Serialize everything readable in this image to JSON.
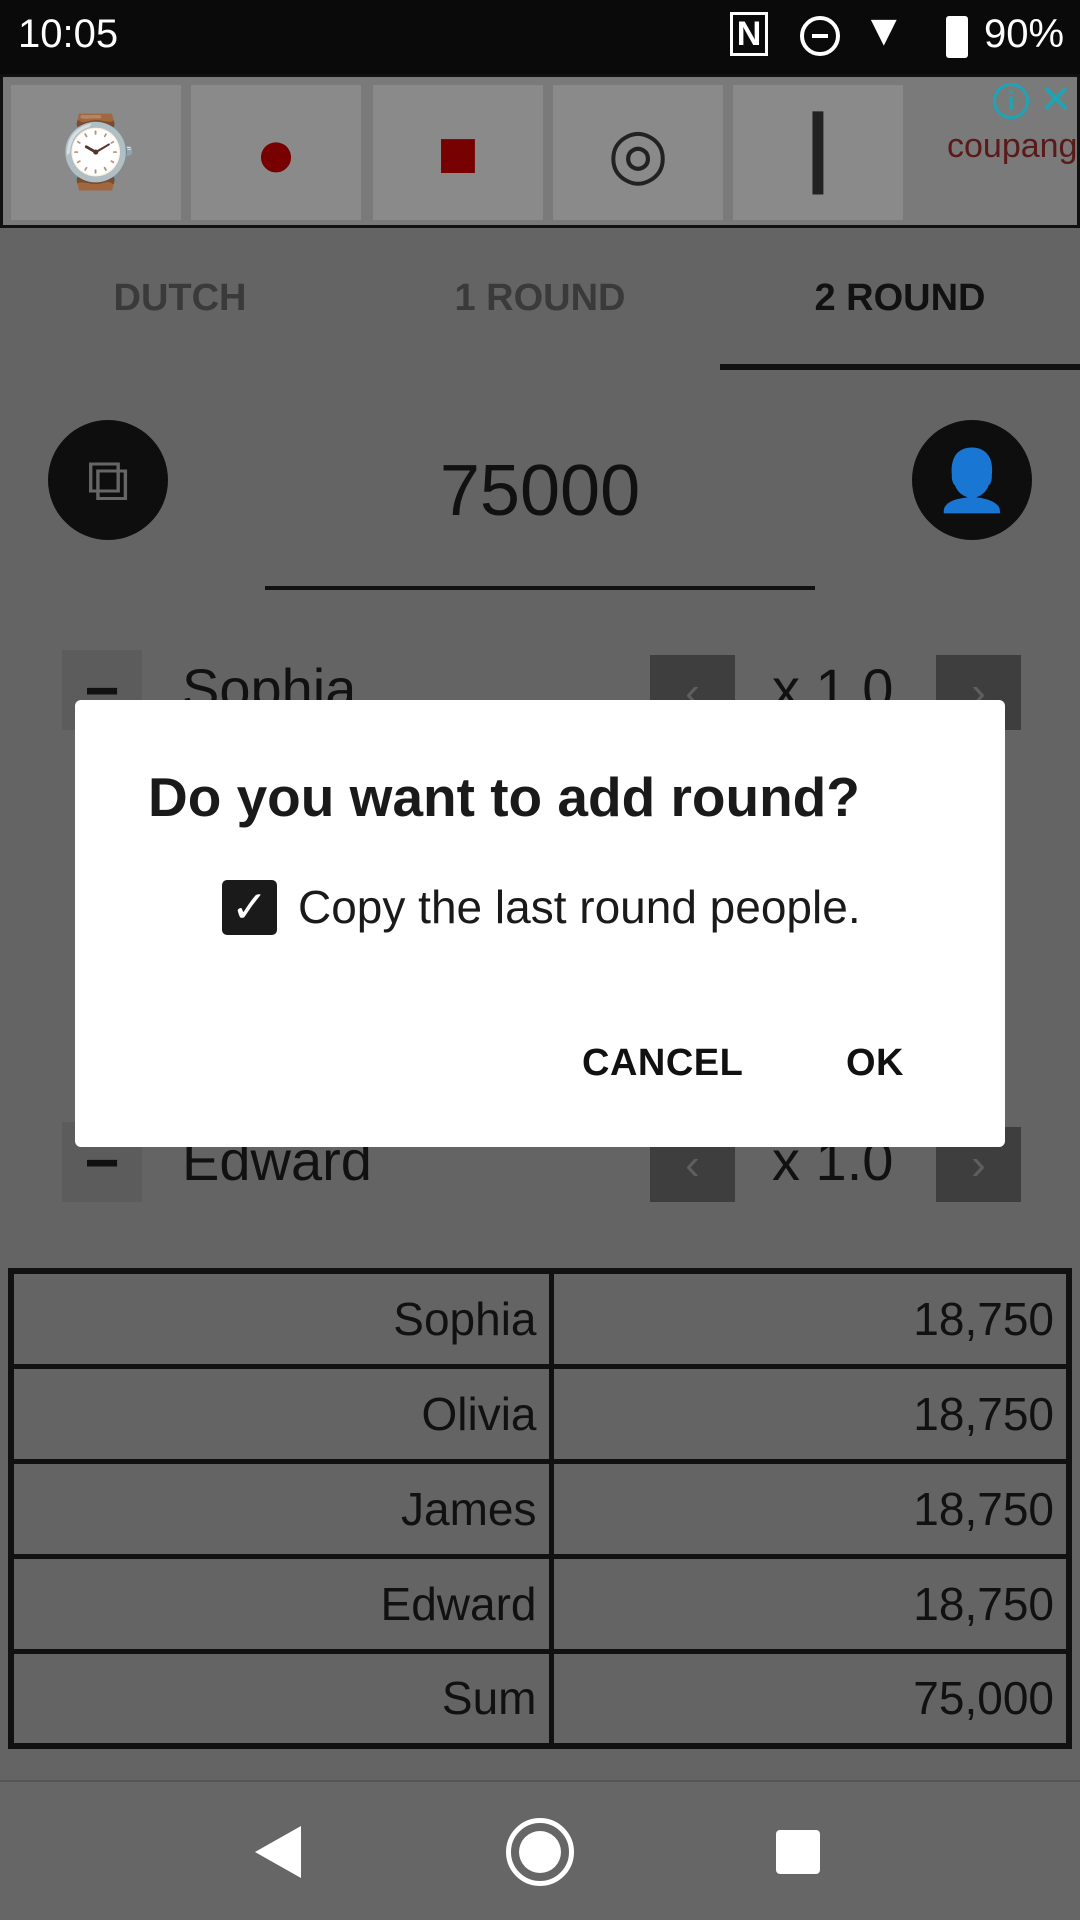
{
  "status_bar": {
    "time": "10:05",
    "battery": "90%",
    "icons": [
      "nfc-icon",
      "dnd-icon",
      "wifi-icon",
      "battery-charging-icon"
    ]
  },
  "ad": {
    "brand": "coupang",
    "items": [
      "watch",
      "red-case",
      "chipmunk-case",
      "steering-wheel",
      "usb-cable"
    ]
  },
  "tabs": [
    {
      "label": "DUTCH"
    },
    {
      "label": "1 ROUND"
    },
    {
      "label": "2 ROUND",
      "selected": true
    }
  ],
  "amount": "75000",
  "people": [
    {
      "name": "Sophia",
      "multiplier": "x 1.0"
    },
    {
      "name": "Edward",
      "multiplier": "x 1.0"
    }
  ],
  "table": [
    {
      "name": "Sophia",
      "value": "18,750"
    },
    {
      "name": "Olivia",
      "value": "18,750"
    },
    {
      "name": "James",
      "value": "18,750"
    },
    {
      "name": "Edward",
      "value": "18,750"
    },
    {
      "name": "Sum",
      "value": "75,000"
    }
  ],
  "dialog": {
    "title": "Do you want to add round?",
    "checkbox_label": "Copy the last round people.",
    "checked": true,
    "cancel": "CANCEL",
    "ok": "OK"
  },
  "colors": {
    "scrim": "#000000",
    "ad_info": "#1aa6b7"
  }
}
